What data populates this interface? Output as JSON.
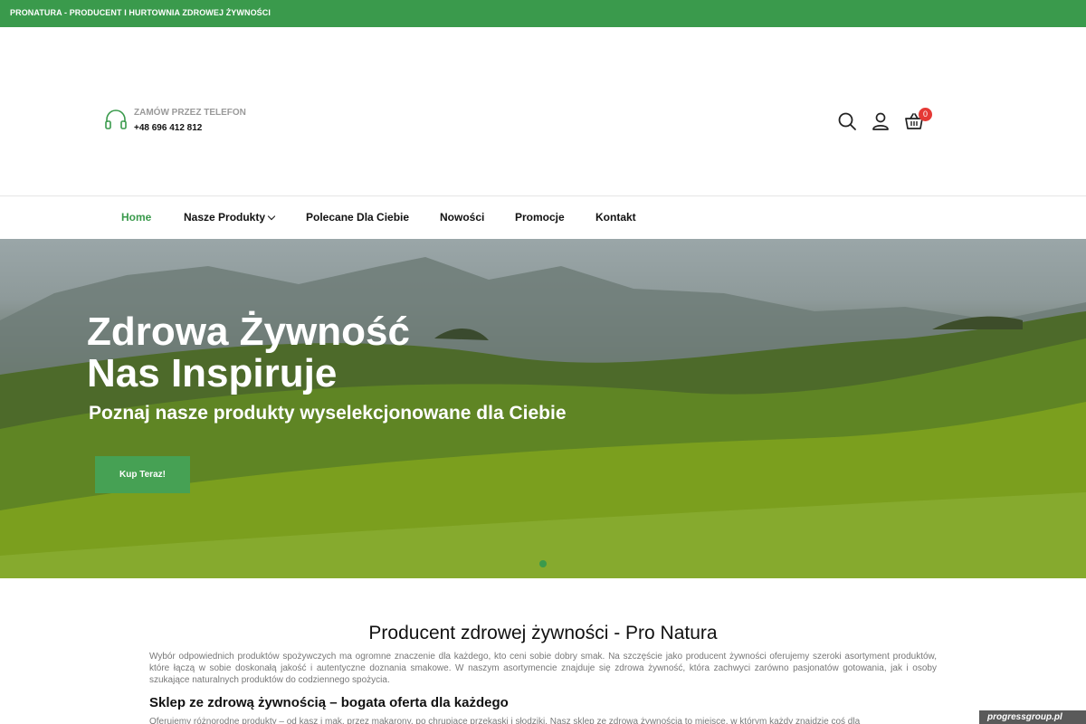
{
  "topbar": {
    "text": "PRONATURA - PRODUCENT I HURTOWNIA ZDROWEJ ŻYWNOŚCI"
  },
  "header": {
    "phone_label": "ZAMÓW PRZEZ TELEFON",
    "phone_number": "+48 696 412 812",
    "icons": [
      "headset-icon",
      "search-icon",
      "user-icon",
      "cart-icon"
    ],
    "cart_count": "0"
  },
  "nav": {
    "items": [
      {
        "label": "Home",
        "active": true
      },
      {
        "label": "Nasze Produkty",
        "dropdown": true
      },
      {
        "label": "Polecane Dla Ciebie"
      },
      {
        "label": "Nowości"
      },
      {
        "label": "Promocje"
      },
      {
        "label": "Kontakt"
      }
    ]
  },
  "hero": {
    "title": "Zdrowa Żywność\nNas Inspiruje",
    "subtitle": "Poznaj nasze produkty wyselekcjonowane dla Ciebie",
    "button": "Kup Teraz!"
  },
  "content": {
    "title": "Producent zdrowej żywności - Pro Natura",
    "paragraph": "Wybór odpowiednich produktów spożywczych ma ogromne znaczenie dla każdego, kto ceni sobie dobry smak. Na szczęście jako producent żywności oferujemy szeroki asortyment produktów, które łączą w sobie doskonałą jakość i autentyczne doznania smakowe. W naszym asortymencie znajduje się zdrowa żywność, która zachwyci zarówno pasjonatów gotowania, jak i osoby szukające naturalnych produktów do codziennego spożycia.",
    "subheading": "Sklep ze zdrową żywnością – bogata oferta dla każdego",
    "paragraph2": "Oferujemy różnorodne produkty – od kasz i mąk, przez makarony, po chrupiące przekąski i słodziki. Nasz sklep ze zdrową żywnością to miejsce, w którym każdy znajdzie coś dla"
  },
  "watermark": "progressgroup.pl",
  "colors": {
    "brand_green": "#3a9a4c",
    "button_green": "#46a154",
    "badge_red": "#e53935"
  }
}
